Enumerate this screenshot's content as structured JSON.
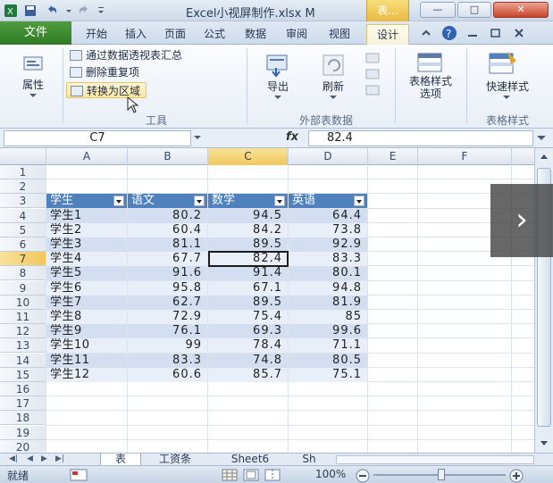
{
  "window": {
    "title": "Excel小视屏制作.xlsx M",
    "tool_tab": "表..."
  },
  "ribbon_tabs": {
    "file": "文件",
    "items": [
      "开始",
      "插入",
      "页面",
      "公式",
      "数据",
      "审阅",
      "视图",
      "设计"
    ]
  },
  "ribbon": {
    "properties_label": "属性",
    "tools": {
      "summarize_pivot": "通过数据透视表汇总",
      "remove_duplicates": "删除重复项",
      "convert_to_range": "转换为区域",
      "group_label": "工具"
    },
    "external": {
      "export_label": "导出",
      "refresh_label": "刷新",
      "group_label": "外部表数据"
    },
    "style_options_label": "表格样式\n选项",
    "quick_styles_label": "快速样式",
    "styles_group_label": "表格样式"
  },
  "formula_bar": {
    "name_box": "C7",
    "fx": "fx",
    "value": "82.4"
  },
  "columns": [
    "A",
    "B",
    "C",
    "D",
    "E",
    "F"
  ],
  "rows": [
    "1",
    "2",
    "3",
    "4",
    "5",
    "6",
    "7",
    "8",
    "9",
    "10",
    "11",
    "12",
    "13",
    "14",
    "15",
    "16",
    "17",
    "18",
    "19",
    "20"
  ],
  "table": {
    "headers": [
      "学生",
      "语文",
      "数学",
      "英语"
    ],
    "data": [
      [
        "学生1",
        "80.2",
        "94.5",
        "64.4"
      ],
      [
        "学生2",
        "60.4",
        "84.2",
        "73.8"
      ],
      [
        "学生3",
        "81.1",
        "89.5",
        "92.9"
      ],
      [
        "学生4",
        "67.7",
        "82.4",
        "83.3"
      ],
      [
        "学生5",
        "91.6",
        "91.4",
        "80.1"
      ],
      [
        "学生6",
        "95.8",
        "67.1",
        "94.8"
      ],
      [
        "学生7",
        "62.7",
        "89.5",
        "81.9"
      ],
      [
        "学生8",
        "72.9",
        "75.4",
        "85"
      ],
      [
        "学生9",
        "76.1",
        "69.3",
        "99.6"
      ],
      [
        "学生10",
        "99",
        "78.4",
        "71.1"
      ],
      [
        "学生11",
        "83.3",
        "74.8",
        "80.5"
      ],
      [
        "学生12",
        "60.6",
        "85.7",
        "75.1"
      ]
    ]
  },
  "sheets": [
    "表",
    "工资条",
    "Sheet6",
    "Sh"
  ],
  "status": {
    "ready": "就绪",
    "zoom": "100%"
  },
  "colors": {
    "table_header": "#4f81bd",
    "band_dark": "#d3dff0",
    "band_light": "#e9eff8",
    "file_tab": "#2f7a25",
    "active_header": "#f1c75a"
  }
}
